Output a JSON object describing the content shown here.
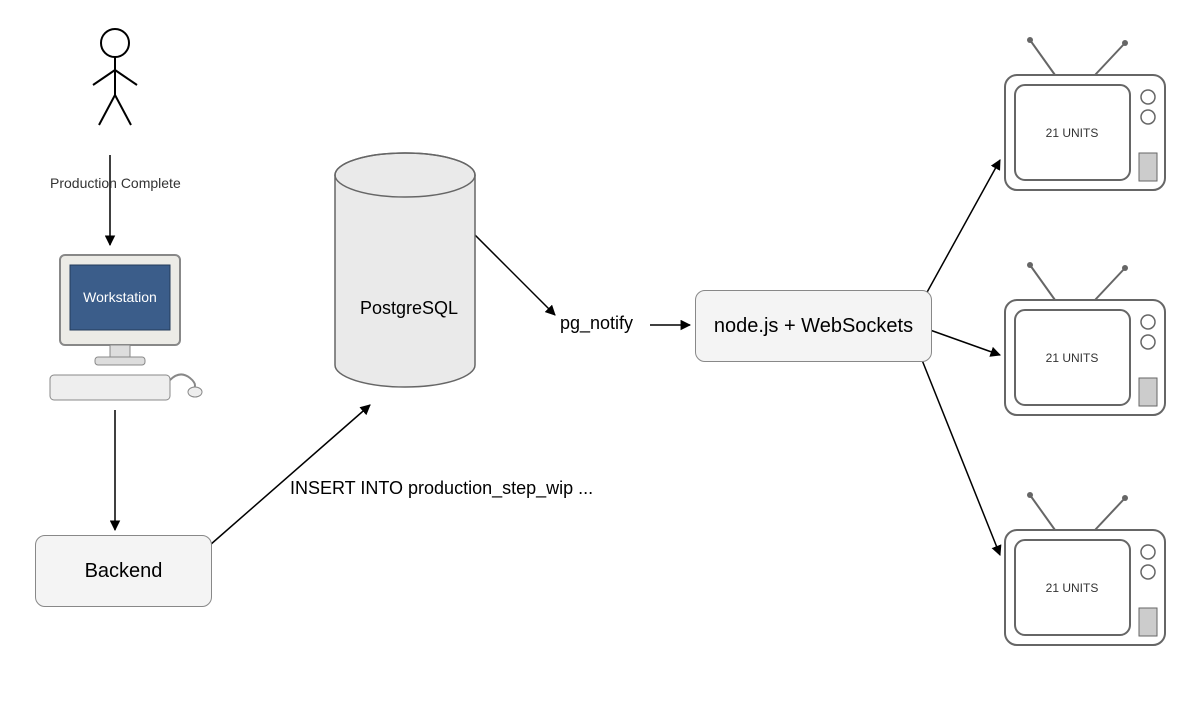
{
  "actor": {
    "label": "Production Complete"
  },
  "workstation": {
    "screen_text": "Workstation"
  },
  "backend": {
    "label": "Backend"
  },
  "sql_text": "INSERT INTO production_step_wip ...",
  "database": {
    "label": "PostgreSQL"
  },
  "notify_label": "pg_notify",
  "server": {
    "label": "node.js + WebSockets"
  },
  "tv_displays": [
    {
      "text": "21 UNITS"
    },
    {
      "text": "21 UNITS"
    },
    {
      "text": "21 UNITS"
    }
  ]
}
